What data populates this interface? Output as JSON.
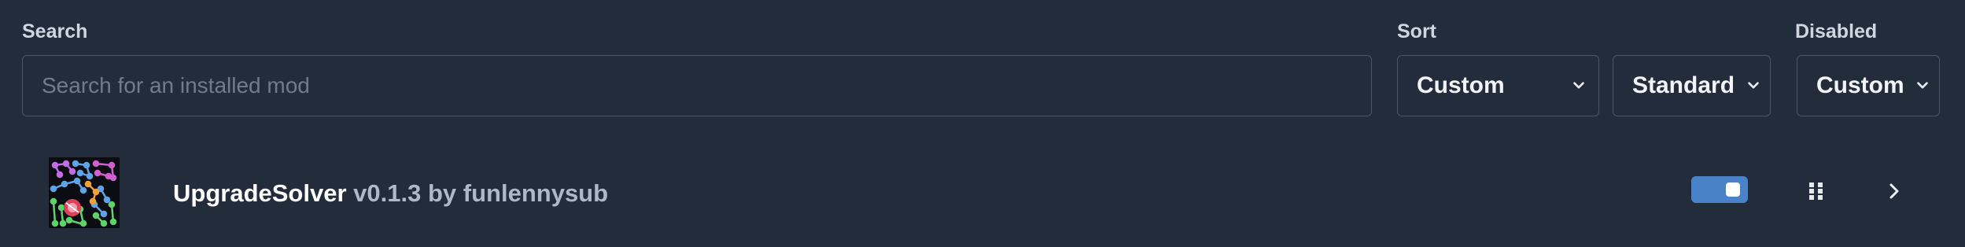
{
  "filters": {
    "search": {
      "label": "Search",
      "placeholder": "Search for an installed mod",
      "value": ""
    },
    "sort": {
      "label": "Sort",
      "primary_value": "Custom",
      "secondary_value": "Standard"
    },
    "disabled": {
      "label": "Disabled",
      "value": "Custom"
    }
  },
  "mods": [
    {
      "name": "UpgradeSolver",
      "version": "v0.1.3",
      "by": "by",
      "author": "funlennysub",
      "enabled": true,
      "icon": "upgrade-solver-thumbnail"
    }
  ],
  "colors": {
    "background": "#232c3b",
    "border": "#4a5567",
    "accent": "#4a82c8",
    "muted_text": "#aeb8c7"
  },
  "icons": {
    "select_chevron": "chevron-down-icon",
    "drag": "drag-handle-icon",
    "expand": "chevron-right-icon"
  }
}
